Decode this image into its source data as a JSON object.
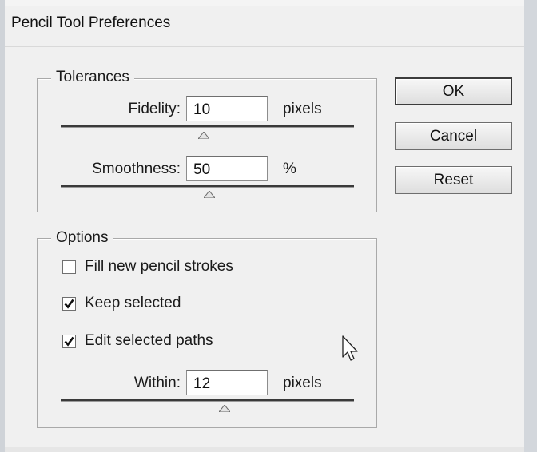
{
  "dialog": {
    "title": "Pencil Tool Preferences"
  },
  "tolerances": {
    "legend": "Tolerances",
    "fidelity": {
      "label": "Fidelity:",
      "value": "10",
      "unit": "pixels"
    },
    "smoothness": {
      "label": "Smoothness:",
      "value": "50",
      "unit": "%"
    }
  },
  "options": {
    "legend": "Options",
    "fill_new": {
      "label": "Fill new pencil strokes",
      "checked": false
    },
    "keep_selected": {
      "label": "Keep selected",
      "checked": true
    },
    "edit_selected": {
      "label": "Edit selected paths",
      "checked": true
    },
    "within": {
      "label": "Within:",
      "value": "12",
      "unit": "pixels"
    }
  },
  "buttons": {
    "ok": "OK",
    "cancel": "Cancel",
    "reset": "Reset"
  },
  "icons": {
    "check": "checkmark-icon",
    "slider_thumb": "triangle-up-icon",
    "cursor": "mouse-pointer-icon"
  }
}
